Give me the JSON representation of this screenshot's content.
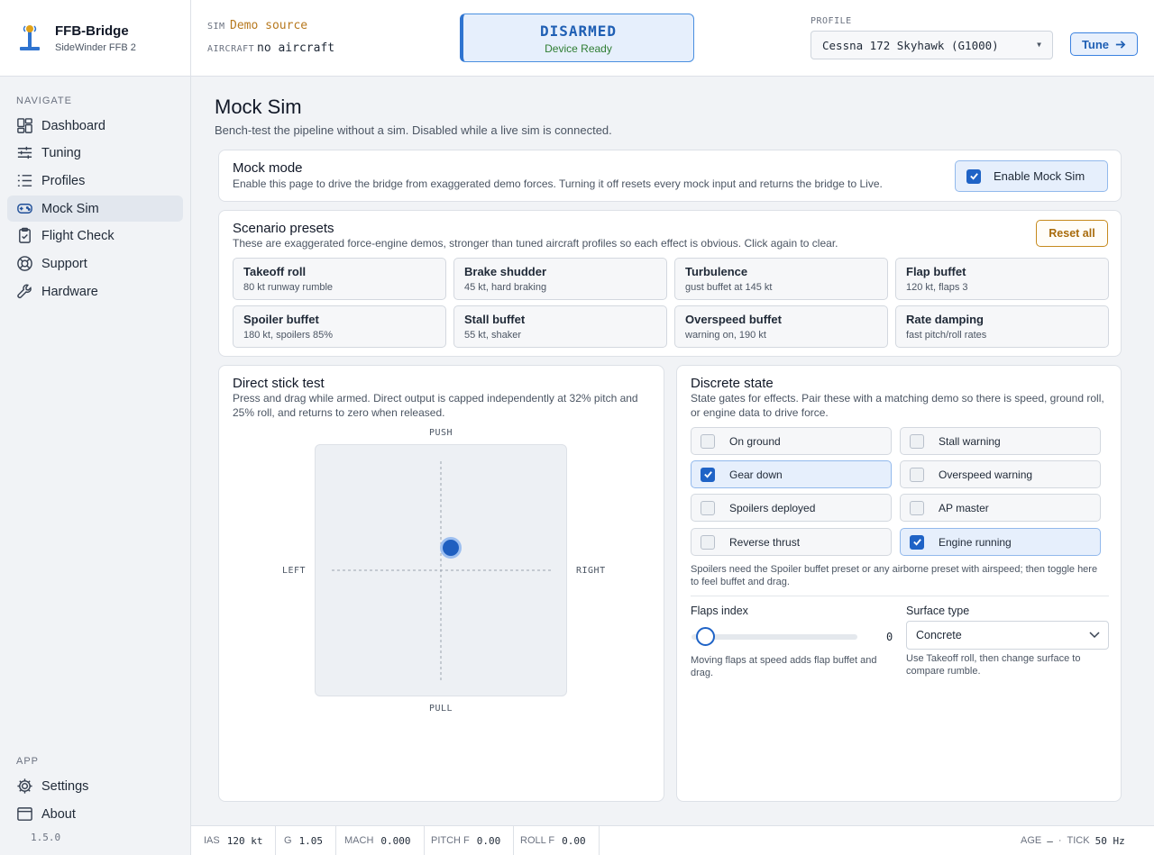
{
  "app": {
    "name": "FFB-Bridge",
    "device": "SideWinder FFB 2",
    "version": "1.5.0"
  },
  "nav": {
    "heading": "NAVIGATE",
    "items": [
      {
        "label": "Dashboard",
        "icon": "dashboard-icon"
      },
      {
        "label": "Tuning",
        "icon": "sliders-icon"
      },
      {
        "label": "Profiles",
        "icon": "list-icon"
      },
      {
        "label": "Mock Sim",
        "icon": "gamepad-icon",
        "active": true
      },
      {
        "label": "Flight Check",
        "icon": "clipboard-check-icon"
      },
      {
        "label": "Support",
        "icon": "lifebuoy-icon"
      },
      {
        "label": "Hardware",
        "icon": "wrench-icon"
      }
    ],
    "app_heading": "APP",
    "app_items": [
      {
        "label": "Settings",
        "icon": "gear-icon"
      },
      {
        "label": "About",
        "icon": "window-icon"
      }
    ]
  },
  "header": {
    "sim_label": "SIM",
    "sim_value": "Demo source",
    "aircraft_label": "AIRCRAFT",
    "aircraft_value": "no aircraft",
    "status_title": "DISARMED",
    "status_sub": "Device Ready",
    "profile_label": "PROFILE",
    "profile_value": "Cessna 172 Skyhawk (G1000)",
    "tune_label": "Tune",
    "accent": "#1f63c6"
  },
  "page": {
    "title": "Mock Sim",
    "subtitle": "Bench-test the pipeline without a sim. Disabled while a live sim is connected."
  },
  "mock_mode": {
    "title": "Mock mode",
    "desc": "Enable this page to drive the bridge from exaggerated demo forces. Turning it off resets every mock input and returns the bridge to Live.",
    "enable_label": "Enable Mock Sim",
    "enabled": true
  },
  "presets": {
    "title": "Scenario presets",
    "desc": "These are exaggerated force-engine demos, stronger than tuned aircraft profiles so each effect is obvious. Click again to clear.",
    "reset_label": "Reset all",
    "items": [
      {
        "name": "Takeoff roll",
        "detail": "80 kt runway rumble"
      },
      {
        "name": "Brake shudder",
        "detail": "45 kt, hard braking"
      },
      {
        "name": "Turbulence",
        "detail": "gust buffet at 145 kt"
      },
      {
        "name": "Flap buffet",
        "detail": "120 kt, flaps 3"
      },
      {
        "name": "Spoiler buffet",
        "detail": "180 kt, spoilers 85%"
      },
      {
        "name": "Stall buffet",
        "detail": "55 kt, shaker"
      },
      {
        "name": "Overspeed buffet",
        "detail": "warning on, 190 kt"
      },
      {
        "name": "Rate damping",
        "detail": "fast pitch/roll rates"
      }
    ]
  },
  "stick": {
    "title": "Direct stick test",
    "desc": "Press and drag while armed. Direct output is capped independently at 32% pitch and 25% roll, and returns to zero when released.",
    "push": "PUSH",
    "pull": "PULL",
    "left": "LEFT",
    "right": "RIGHT"
  },
  "discrete": {
    "title": "Discrete state",
    "desc": "State gates for effects. Pair these with a matching demo so there is speed, ground roll, or engine data to drive force.",
    "toggles": [
      {
        "label": "On ground",
        "on": false
      },
      {
        "label": "Stall warning",
        "on": false
      },
      {
        "label": "Gear down",
        "on": true
      },
      {
        "label": "Overspeed warning",
        "on": false
      },
      {
        "label": "Spoilers deployed",
        "on": false
      },
      {
        "label": "AP master",
        "on": false
      },
      {
        "label": "Reverse thrust",
        "on": false
      },
      {
        "label": "Engine running",
        "on": true
      }
    ],
    "note": "Spoilers need the Spoiler buffet preset or any airborne preset with airspeed; then toggle here to feel buffet and drag.",
    "flaps_label": "Flaps index",
    "flaps_value": "0",
    "flaps_note": "Moving flaps at speed adds flap buffet and drag.",
    "surface_label": "Surface type",
    "surface_value": "Concrete",
    "surface_note": "Use Takeoff roll, then change surface to compare rumble."
  },
  "statusbar": {
    "ias_label": "IAS",
    "ias_value": "120 kt",
    "g_label": "G",
    "g_value": "1.05",
    "mach_label": "MACH",
    "mach_value": "0.000",
    "pitch_label": "PITCH F",
    "pitch_value": "0.00",
    "roll_label": "ROLL F",
    "roll_value": "0.00",
    "age_label": "AGE",
    "age_value": "—",
    "sep": "·",
    "tick_label": "TICK",
    "tick_value": "50 Hz"
  }
}
